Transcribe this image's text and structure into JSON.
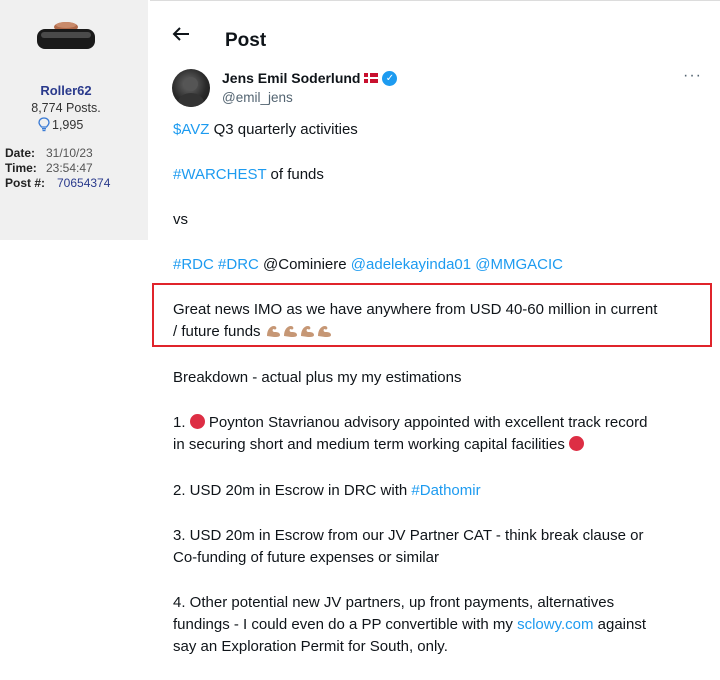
{
  "sidebar": {
    "username": "Roller62",
    "posts": "8,774 Posts.",
    "likes": "1,995",
    "date_label": "Date:",
    "date_value": "31/10/23",
    "time_label": "Time:",
    "time_value": "23:54:47",
    "post_label": "Post #:",
    "post_value": "70654374"
  },
  "header": {
    "back_icon": "arrow-left-icon",
    "title": "Post"
  },
  "author": {
    "name": "Jens Emil Soderlund",
    "flag": "denmark-flag-icon",
    "verified_icon": "verified-badge-icon",
    "handle": "@emil_jens",
    "more_icon": "more-icon"
  },
  "tweet": {
    "l1_link": "$AVZ",
    "l1_text": " Q3 quarterly activities",
    "l2_link": "#WARCHEST",
    "l2_text": " of funds",
    "l3": "vs",
    "l4_tag1": "#RDC",
    "l4_tag2": "#DRC",
    "l4_text": " @Cominiere ",
    "l4_m1": "@adelekayinda01",
    "l4_m2": "@MMGACIC",
    "l5a": "Great news IMO as we have anywhere from USD 40-60 million in current",
    "l5b": "/ future funds ",
    "l6": "Breakdown - actual plus my my estimations",
    "l7a_pre": "1. ",
    "l7a_text": " Poynton Stavrianou advisory appointed with excellent track record",
    "l7b": "in securing short and medium term working capital facilities ",
    "l8_text": "2. USD 20m in Escrow in DRC with ",
    "l8_link": "#Dathomir",
    "l9a": "3. USD 20m in Escrow from our JV Partner CAT - think break clause or",
    "l9b": "Co-funding of future expenses or similar",
    "l10a": "4. Other potential new JV partners, up front payments, alternatives",
    "l10b_pre": "fundings - I could even do a PP convertible with my ",
    "l10b_link": "sclowy.com",
    "l10b_post": " against",
    "l10c": "say an Exploration Permit for South, only."
  },
  "colors": {
    "link": "#1d9bf0",
    "highlight_border": "#e0242b",
    "username": "#2a3a8c"
  }
}
